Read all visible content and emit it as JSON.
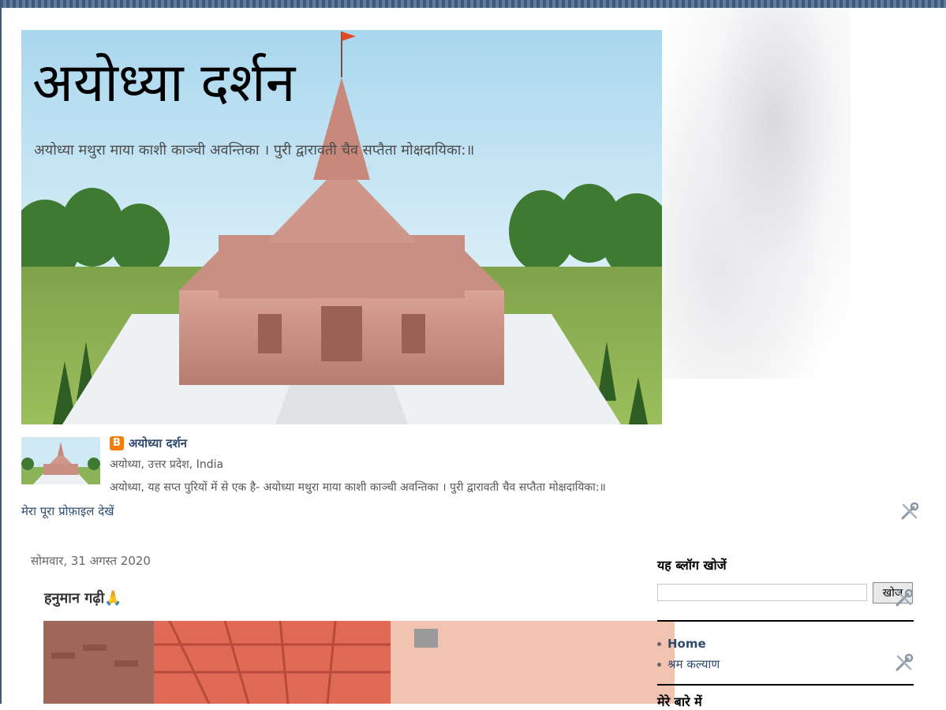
{
  "header": {
    "title": "अयोध्या दर्शन",
    "description": "अयोध्या मथुरा माया काशी काञ्ची अवन्तिका । पुरी द्वारावती चैव सप्तैता मोक्षदायिका:॥"
  },
  "profile": {
    "name": "अयोध्या दर्शन",
    "location": "अयोध्या, उत्तर प्रदेश, India",
    "about": "अयोध्या, यह सप्त पुरियों में से एक है- अयोध्या मथुरा माया काशी काञ्ची अवन्तिका । पुरी द्वारावती चैव सप्तैता मोक्षदायिका:॥",
    "view_profile_label": "मेरा पूरा प्रोफ़ाइल देखें",
    "blogger_icon_letter": "B"
  },
  "post": {
    "date": "सोमवार, 31 अगस्त 2020",
    "title": "हनुमान गढ़ी🙏"
  },
  "sidebar": {
    "search_title": "यह ब्लॉग खोजें",
    "search_value": "",
    "search_button": "खोज",
    "pages": [
      {
        "label": "Home",
        "active": true
      },
      {
        "label": "श्रम कल्याण",
        "active": false
      }
    ],
    "next_heading": "मेरे बारे में"
  },
  "colors": {
    "frame": "#3c5a7a",
    "link": "#2e4a6e",
    "blogger_orange": "#f57d00"
  },
  "icons": [
    "blogger-icon",
    "wrench-screwdriver-icon"
  ]
}
